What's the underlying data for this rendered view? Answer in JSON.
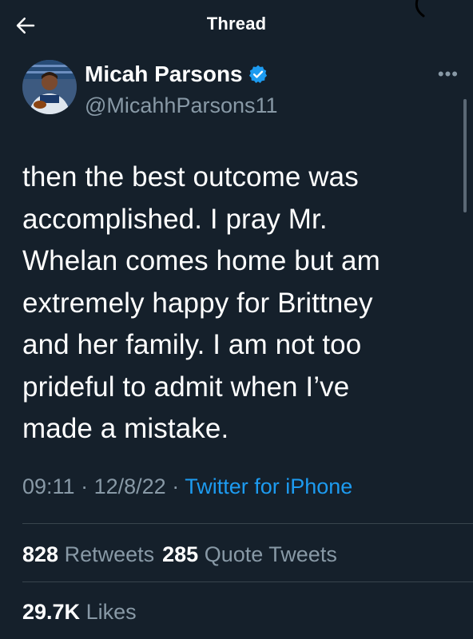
{
  "header": {
    "title": "Thread",
    "back_icon": "arrow-left-icon"
  },
  "author": {
    "name": "Micah Parsons",
    "handle": "@MicahhParsons11",
    "verified_icon": "verified-badge-icon",
    "more_label": "•••"
  },
  "tweet": {
    "text": "then the best outcome was\naccomplished. I pray Mr.\nWhelan comes home but am\nextremely happy for Brittney\nand her family.  I am not too\nprideful to admit when I’ve\nmade a mistake."
  },
  "meta": {
    "time": "09:11",
    "separator": "·",
    "date": "12/8/22",
    "source": "Twitter for iPhone"
  },
  "stats": {
    "retweets_count": "828",
    "retweets_label": "Retweets",
    "quote_count": "285",
    "quote_label": "Quote Tweets",
    "likes_count": "29.7K",
    "likes_label": "Likes"
  },
  "colors": {
    "background": "#15202b",
    "accent": "#1d9bf0",
    "secondary_text": "#8899a6",
    "divider": "#38444d"
  }
}
